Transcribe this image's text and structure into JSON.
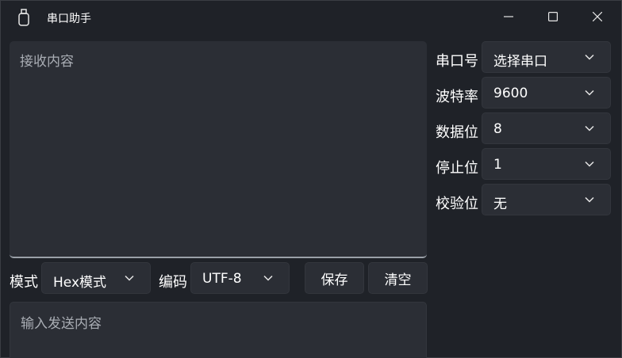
{
  "window": {
    "title": "串口助手",
    "controls": {
      "minimize": "minimize-icon",
      "maximize": "maximize-icon",
      "close": "close-icon"
    }
  },
  "receive": {
    "placeholder": "接收内容"
  },
  "settings": [
    {
      "label": "串口号",
      "value": "选择串口"
    },
    {
      "label": "波特率",
      "value": "9600"
    },
    {
      "label": "数据位",
      "value": "8"
    },
    {
      "label": "停止位",
      "value": "1"
    },
    {
      "label": "校验位",
      "value": "无"
    }
  ],
  "toolbar": {
    "mode_label": "模式",
    "mode_value": "Hex模式",
    "encoding_label": "编码",
    "encoding_value": "UTF-8",
    "save_label": "保存",
    "clear_label": "清空"
  },
  "send": {
    "placeholder": "输入发送内容"
  },
  "colors": {
    "background": "#1f2228",
    "control": "#2b2e35",
    "text": "#ffffff",
    "placeholder": "#a9adb4"
  }
}
